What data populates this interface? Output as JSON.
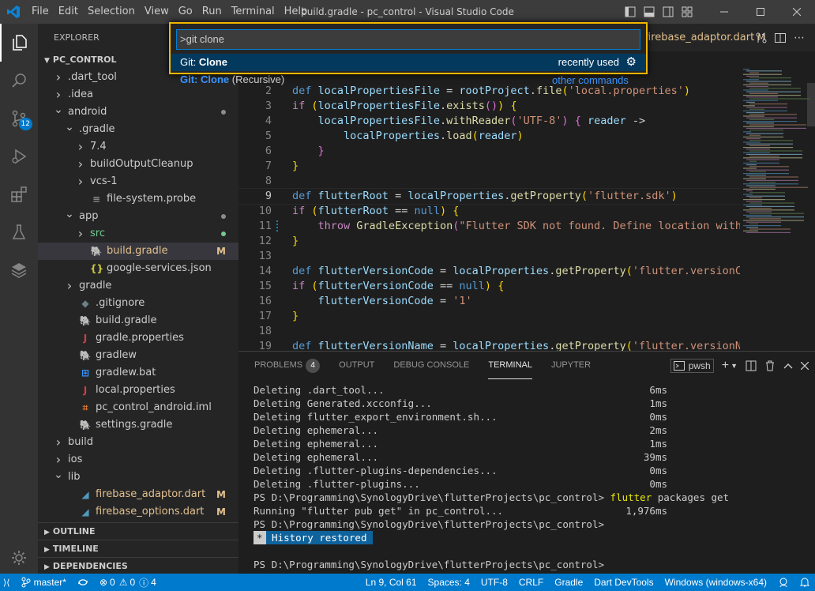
{
  "titlebar": {
    "menus": [
      "File",
      "Edit",
      "Selection",
      "View",
      "Go",
      "Run",
      "Terminal",
      "Help"
    ],
    "title": "build.gradle - pc_control - Visual Studio Code"
  },
  "activity": {
    "scm_badge": "12"
  },
  "sidebar": {
    "header": "EXPLORER",
    "root": "PC_CONTROL",
    "items": [
      {
        "label": ".dart_tool",
        "depth": 1,
        "kind": "folder",
        "open": false
      },
      {
        "label": ".idea",
        "depth": 1,
        "kind": "folder",
        "open": false
      },
      {
        "label": "android",
        "depth": 1,
        "kind": "folder",
        "open": true,
        "dot": "#8c8c8c"
      },
      {
        "label": ".gradle",
        "depth": 2,
        "kind": "folder",
        "open": true
      },
      {
        "label": "7.4",
        "depth": 3,
        "kind": "folder",
        "open": false
      },
      {
        "label": "buildOutputCleanup",
        "depth": 3,
        "kind": "folder",
        "open": false
      },
      {
        "label": "vcs-1",
        "depth": 3,
        "kind": "folder",
        "open": false
      },
      {
        "label": "file-system.probe",
        "depth": 3,
        "kind": "file",
        "icon": "≡",
        "icolor": "#8c8c8c"
      },
      {
        "label": "app",
        "depth": 2,
        "kind": "folder",
        "open": true,
        "dot": "#8c8c8c"
      },
      {
        "label": "src",
        "depth": 3,
        "kind": "folder",
        "open": false,
        "dot": "#73c991",
        "lcolor": "#73c991"
      },
      {
        "label": "build.gradle",
        "depth": 3,
        "kind": "file",
        "icon": "🐘",
        "icolor": "#4a9fd6",
        "mod": "M",
        "lcolor": "#e2c08d",
        "selected": true
      },
      {
        "label": "google-services.json",
        "depth": 3,
        "kind": "file",
        "icon": "{}",
        "icolor": "#cbcb41"
      },
      {
        "label": "gradle",
        "depth": 2,
        "kind": "folder",
        "open": false
      },
      {
        "label": ".gitignore",
        "depth": 2,
        "kind": "file",
        "icon": "◆",
        "icolor": "#6d8086"
      },
      {
        "label": "build.gradle",
        "depth": 2,
        "kind": "file",
        "icon": "🐘",
        "icolor": "#4a9fd6"
      },
      {
        "label": "gradle.properties",
        "depth": 2,
        "kind": "file",
        "icon": "J",
        "icolor": "#cc3e44"
      },
      {
        "label": "gradlew",
        "depth": 2,
        "kind": "file",
        "icon": "🐘",
        "icolor": "#4a9fd6"
      },
      {
        "label": "gradlew.bat",
        "depth": 2,
        "kind": "file",
        "icon": "⊞",
        "icolor": "#3794ff"
      },
      {
        "label": "local.properties",
        "depth": 2,
        "kind": "file",
        "icon": "J",
        "icolor": "#cc3e44"
      },
      {
        "label": "pc_control_android.iml",
        "depth": 2,
        "kind": "file",
        "icon": "⌗",
        "icolor": "#e37933"
      },
      {
        "label": "settings.gradle",
        "depth": 2,
        "kind": "file",
        "icon": "🐘",
        "icolor": "#4a9fd6"
      },
      {
        "label": "build",
        "depth": 1,
        "kind": "folder",
        "open": false
      },
      {
        "label": "ios",
        "depth": 1,
        "kind": "folder",
        "open": false
      },
      {
        "label": "lib",
        "depth": 1,
        "kind": "folder",
        "open": true
      },
      {
        "label": "firebase_adaptor.dart",
        "depth": 2,
        "kind": "file",
        "icon": "◢",
        "icolor": "#519aba",
        "mod": "M",
        "lcolor": "#e2c08d"
      },
      {
        "label": "firebase_options.dart",
        "depth": 2,
        "kind": "file",
        "icon": "◢",
        "icolor": "#519aba",
        "mod": "M",
        "lcolor": "#e2c08d"
      }
    ],
    "sections": [
      "OUTLINE",
      "TIMELINE",
      "DEPENDENCIES"
    ]
  },
  "tabs": {
    "active_tab": "firebase_adaptor.dart",
    "active_mod": "M"
  },
  "palette": {
    "input_value": ">git clone",
    "items": [
      {
        "prefix": "Git:",
        "hl": "Clone",
        "rest": "",
        "right": "recently used"
      },
      {
        "prefix": "Git:",
        "hl": "Clone",
        "rest": " (Recursive)",
        "right": "other commands"
      }
    ]
  },
  "editor": {
    "lines": [
      {
        "n": "2",
        "html": "<span class='kw'>def</span> <span class='var'>localPropertiesFile</span> <span class='pl'>=</span> <span class='var'>rootProject</span><span class='pl'>.</span><span class='fn'>file</span><span class='pn'>(</span><span class='str'>'local.properties'</span><span class='pn'>)</span>"
      },
      {
        "n": "3",
        "html": "<span class='ctl'>if</span> <span class='pn'>(</span><span class='var'>localPropertiesFile</span><span class='pl'>.</span><span class='fn'>exists</span><span class='pn2'>()</span><span class='pn'>)</span> <span class='pn'>{</span>"
      },
      {
        "n": "4",
        "html": "    <span class='var'>localPropertiesFile</span><span class='pl'>.</span><span class='fn'>withReader</span><span class='pn2'>(</span><span class='str'>'UTF-8'</span><span class='pn2'>)</span> <span class='pn2'>{</span> <span class='var'>reader</span> <span class='pl'>-&gt;</span>"
      },
      {
        "n": "5",
        "html": "        <span class='var'>localProperties</span><span class='pl'>.</span><span class='fn'>load</span><span class='pn'>(</span><span class='var'>reader</span><span class='pn'>)</span>"
      },
      {
        "n": "6",
        "html": "    <span class='pn2'>}</span>"
      },
      {
        "n": "7",
        "html": "<span class='pn'>}</span>"
      },
      {
        "n": "8",
        "html": ""
      },
      {
        "n": "9",
        "html": "<span class='kw'>def</span> <span class='var'>flutterRoot</span> <span class='pl'>=</span> <span class='var'>localProperties</span><span class='pl'>.</span><span class='fn'>getProperty</span><span class='pn'>(</span><span class='str'>'flutter.sdk'</span><span class='pn'>)</span>",
        "cur": true
      },
      {
        "n": "10",
        "html": "<span class='ctl'>if</span> <span class='pn'>(</span><span class='var'>flutterRoot</span> <span class='pl'>==</span> <span class='kw'>null</span><span class='pn'>)</span> <span class='pn'>{</span>"
      },
      {
        "n": "11",
        "html": "    <span class='ctl'>throw</span> <span class='fn'>GradleException</span><span class='pn2'>(</span><span class='str'>\"Flutter SDK not found. Define location with flu</span>"
      },
      {
        "n": "12",
        "html": "<span class='pn'>}</span>"
      },
      {
        "n": "13",
        "html": ""
      },
      {
        "n": "14",
        "html": "<span class='kw'>def</span> <span class='var'>flutterVersionCode</span> <span class='pl'>=</span> <span class='var'>localProperties</span><span class='pl'>.</span><span class='fn'>getProperty</span><span class='pn'>(</span><span class='str'>'flutter.versionCode'</span><span class='pn'>)</span>"
      },
      {
        "n": "15",
        "html": "<span class='ctl'>if</span> <span class='pn'>(</span><span class='var'>flutterVersionCode</span> <span class='pl'>==</span> <span class='kw'>null</span><span class='pn'>)</span> <span class='pn'>{</span>"
      },
      {
        "n": "16",
        "html": "    <span class='var'>flutterVersionCode</span> <span class='pl'>=</span> <span class='str'>'1'</span>"
      },
      {
        "n": "17",
        "html": "<span class='pn'>}</span>"
      },
      {
        "n": "18",
        "html": ""
      },
      {
        "n": "19",
        "html": "<span class='kw'>def</span> <span class='var'>flutterVersionName</span> <span class='pl'>=</span> <span class='var'>localProperties</span><span class='pl'>.</span><span class='fn'>getProperty</span><span class='pn'>(</span><span class='str'>'flutter.versionName'</span><span class='pn'>)</span>"
      }
    ]
  },
  "panel": {
    "tabs": [
      "PROBLEMS",
      "OUTPUT",
      "DEBUG CONSOLE",
      "TERMINAL",
      "JUPYTER"
    ],
    "problems_count": "4",
    "active_tab": "TERMINAL",
    "shell": "pwsh",
    "terminal_lines": [
      {
        "text": "Deleting .dart_tool...",
        "dur": "6ms"
      },
      {
        "text": "Deleting Generated.xcconfig...",
        "dur": "1ms"
      },
      {
        "text": "Deleting flutter_export_environment.sh...",
        "dur": "0ms"
      },
      {
        "text": "Deleting ephemeral...",
        "dur": "2ms"
      },
      {
        "text": "Deleting ephemeral...",
        "dur": "1ms"
      },
      {
        "text": "Deleting ephemeral...",
        "dur": "39ms"
      },
      {
        "text": "Deleting .flutter-plugins-dependencies...",
        "dur": "0ms"
      },
      {
        "text": "Deleting .flutter-plugins...",
        "dur": "0ms"
      }
    ],
    "prompt1": "PS D:\\Programming\\SynologyDrive\\flutterProjects\\pc_control> ",
    "cmd_word": "flutter",
    "cmd_rest": " packages get",
    "running_line": "Running \"flutter pub get\" in pc_control...",
    "running_dur": "1,976ms",
    "prompt2": "PS D:\\Programming\\SynologyDrive\\flutterProjects\\pc_control>",
    "restored_star": "*",
    "restored_text": " History restored ",
    "prompt3": "PS D:\\Programming\\SynologyDrive\\flutterProjects\\pc_control>"
  },
  "statusbar": {
    "branch": "master*",
    "errors": "0",
    "warnings": "0",
    "info": "4",
    "position": "Ln 9, Col 61",
    "spaces": "Spaces: 4",
    "encoding": "UTF-8",
    "eol": "CRLF",
    "language": "Gradle",
    "devtools": "Dart DevTools",
    "device": "Windows (windows-x64)"
  },
  "colors": {
    "accent": "#007acc",
    "palette_border": "#f2b700"
  }
}
